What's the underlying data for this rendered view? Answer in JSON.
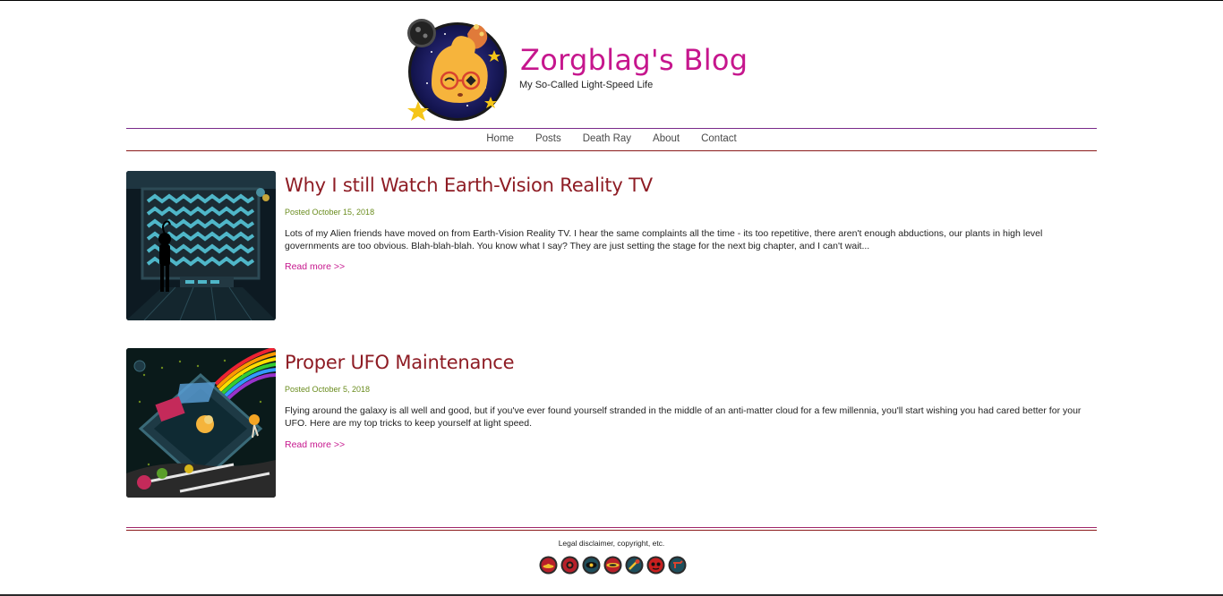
{
  "site": {
    "title": "Zorgblag's Blog",
    "tagline": "My So-Called Light-Speed Life"
  },
  "nav": {
    "items": [
      "Home",
      "Posts",
      "Death Ray",
      "About",
      "Contact"
    ]
  },
  "posts": [
    {
      "title": "Why I still Watch Earth-Vision Reality TV",
      "date": "Posted October 15, 2018",
      "excerpt": "Lots of my Alien friends have moved on from Earth-Vision Reality TV. I hear the same complaints all the time - its too repetitive, there aren't enough abductions, our plants in high level governments are too obvious. Blah-blah-blah. You know what I say? They are just setting the stage for the next big chapter, and I can't wait...",
      "read_more": "Read more >>"
    },
    {
      "title": "Proper UFO Maintenance",
      "date": "Posted October 5, 2018",
      "excerpt": "Flying around the galaxy is all well and good, but if you've ever found yourself stranded in the middle of an anti-matter cloud for a few millennia, you'll start wishing you had cared better for your UFO. Here are my top tricks to keep yourself at light speed.",
      "read_more": "Read more >>"
    }
  ],
  "footer": {
    "text": "Legal disclaimer, copyright, etc.",
    "social_icons": [
      {
        "name": "ufo-icon",
        "color": "#b8202a"
      },
      {
        "name": "planet-icon",
        "color": "#b8202a"
      },
      {
        "name": "eye-icon",
        "color": "#1f4f5c"
      },
      {
        "name": "spaceship-icon",
        "color": "#b8202a"
      },
      {
        "name": "comet-icon",
        "color": "#1f4f5c"
      },
      {
        "name": "alien-face-icon",
        "color": "#c91f1f"
      },
      {
        "name": "ray-gun-icon",
        "color": "#1f4f5c"
      }
    ]
  },
  "colors": {
    "title_magenta": "#c6168d",
    "post_title_red": "#8e1c24",
    "date_green": "#6a8c1e",
    "link_magenta": "#c6168d"
  }
}
